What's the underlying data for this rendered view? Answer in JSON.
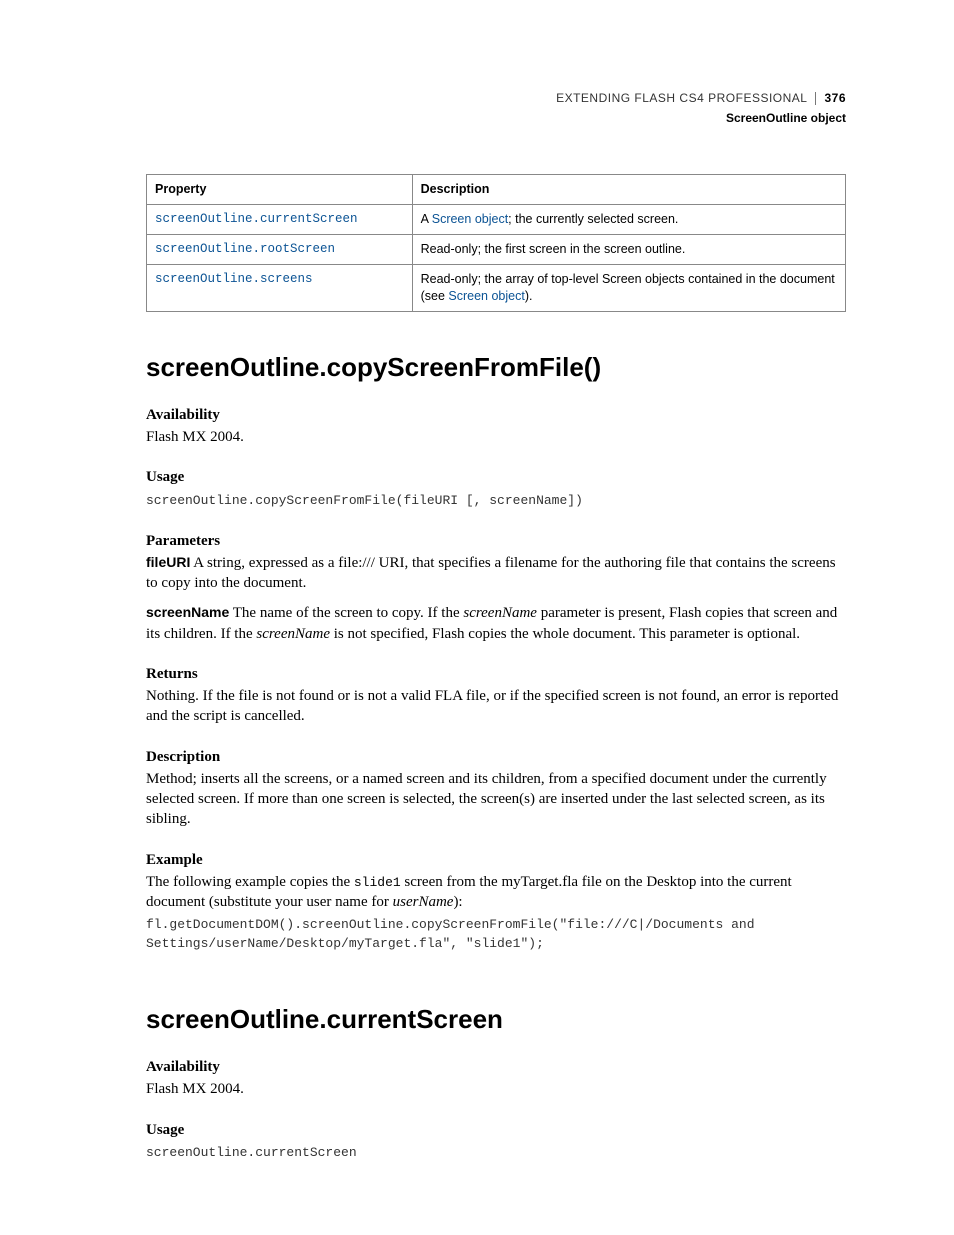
{
  "header": {
    "title": "EXTENDING FLASH CS4 PROFESSIONAL",
    "page_number": "376",
    "subtitle": "ScreenOutline object"
  },
  "table": {
    "head_property": "Property",
    "head_description": "Description",
    "rows": [
      {
        "prop": "screenOutline.currentScreen",
        "desc_prefix": "A ",
        "desc_link": "Screen object",
        "desc_suffix": "; the currently selected screen."
      },
      {
        "prop": "screenOutline.rootScreen",
        "desc_plain": "Read-only; the first screen in the screen outline."
      },
      {
        "prop": "screenOutline.screens",
        "desc_prefix": "Read-only; the array of top-level Screen objects contained in the document (see ",
        "desc_link": "Screen object",
        "desc_suffix": ")."
      }
    ]
  },
  "section1": {
    "title": "screenOutline.copyScreenFromFile()",
    "availability": {
      "label": "Availability",
      "text": "Flash MX 2004."
    },
    "usage": {
      "label": "Usage",
      "code": "screenOutline.copyScreenFromFile(fileURI [, screenName])"
    },
    "parameters": {
      "label": "Parameters",
      "p1_name": "fileURI",
      "p1_text": "  A string, expressed as a file:/// URI, that specifies a filename for the authoring file that contains the screens to copy into the document.",
      "p2_name": "screenName",
      "p2_pre": "  The name of the screen to copy. If the ",
      "p2_ital1": "screenName",
      "p2_mid": " parameter is present, Flash copies that screen and its children. If the ",
      "p2_ital2": "screenName",
      "p2_post": " is not specified, Flash copies the whole document. This parameter is optional."
    },
    "returns": {
      "label": "Returns",
      "text": "Nothing. If the file is not found or is not a valid FLA file, or if the specified screen is not found, an error is reported and the script is cancelled."
    },
    "description": {
      "label": "Description",
      "text": "Method; inserts all the screens, or a named screen and its children, from a specified document under the currently selected screen. If more than one screen is selected, the screen(s) are inserted under the last selected screen, as its sibling."
    },
    "example": {
      "label": "Example",
      "intro_pre": "The following example copies the ",
      "intro_code": "slide1",
      "intro_mid": " screen from the myTarget.fla file on the Desktop into the current document (substitute your user name for ",
      "intro_ital": "userName",
      "intro_post": "):",
      "code": "fl.getDocumentDOM().screenOutline.copyScreenFromFile(\"file:///C|/Documents and \nSettings/userName/Desktop/myTarget.fla\", \"slide1\");"
    }
  },
  "section2": {
    "title": "screenOutline.currentScreen",
    "availability": {
      "label": "Availability",
      "text": "Flash MX 2004."
    },
    "usage": {
      "label": "Usage",
      "code": "screenOutline.currentScreen"
    }
  }
}
